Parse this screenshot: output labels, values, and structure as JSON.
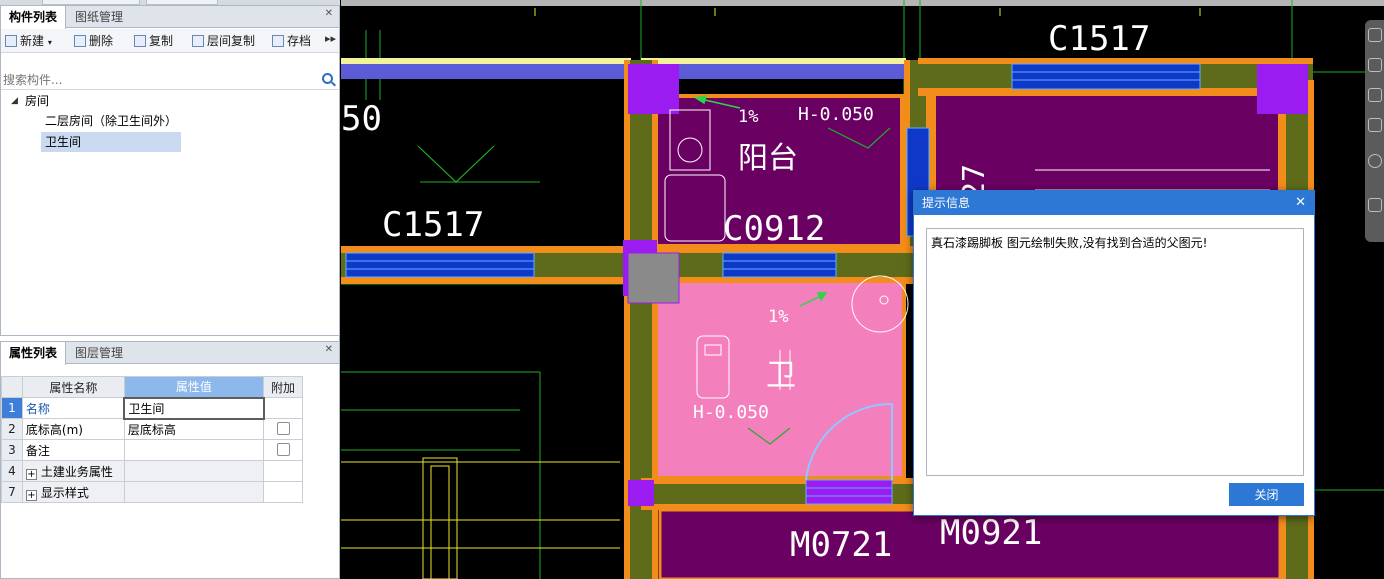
{
  "component_panel": {
    "tabs": [
      "构件列表",
      "图纸管理"
    ],
    "toolbar": {
      "new": "新建",
      "delete": "删除",
      "copy": "复制",
      "floor_copy": "层间复制",
      "archive": "存档"
    },
    "search_placeholder": "搜索构件...",
    "tree": {
      "root": "房间",
      "children": [
        "二层房间（除卫生间外）",
        "卫生间"
      ]
    }
  },
  "property_panel": {
    "tabs": [
      "属性列表",
      "图层管理"
    ],
    "headers": {
      "name": "属性名称",
      "value": "属性值",
      "extra": "附加"
    },
    "rows": [
      {
        "num": "1",
        "name": "名称",
        "value": "卫生间"
      },
      {
        "num": "2",
        "name": "底标高(m)",
        "value": "层底标高"
      },
      {
        "num": "3",
        "name": "备注",
        "value": ""
      },
      {
        "num": "4",
        "name": "土建业务属性",
        "value": ""
      },
      {
        "num": "7",
        "name": "显示样式",
        "value": ""
      }
    ]
  },
  "cad_labels": {
    "c1517_top": "C1517",
    "c1517_left": "C1517",
    "c0912": "C0912",
    "m0721": "M0721",
    "m0921": "M0921",
    "balcony": "阳台",
    "bathroom": "卫",
    "slope1": "1%",
    "slope2": "1%",
    "elev1": "H-0.050",
    "elev2": "H-0.050",
    "edge_left": "50",
    "edge_right": "27"
  },
  "dialog": {
    "title": "提示信息",
    "message": "真石漆踢脚板 图元绘制失败,没有找到合适的父图元!",
    "close_button": "关闭"
  },
  "colors": {
    "accent": "#2c78d4",
    "bathroom_fill": "#f47fbd",
    "room_fill": "#6b0063",
    "wall": "#f28c1a"
  }
}
